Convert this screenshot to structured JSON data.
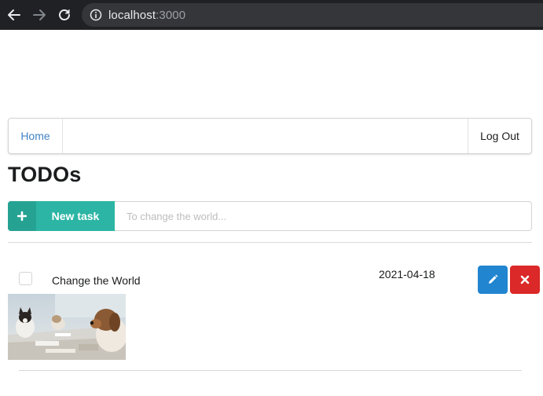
{
  "browser": {
    "url_host": "localhost",
    "url_port": ":3000",
    "back_icon": "arrow-left-icon",
    "forward_icon": "arrow-right-icon",
    "reload_icon": "reload-icon",
    "info_icon": "info-icon"
  },
  "menu": {
    "home_label": "Home",
    "logout_label": "Log Out"
  },
  "page": {
    "title": "TODOs"
  },
  "new_task": {
    "button_label": "New task",
    "button_icon": "plus-icon",
    "input_value": "",
    "input_placeholder": "To change the world..."
  },
  "todos": [
    {
      "checked": false,
      "title": "Change the World",
      "date": "2021-04-18",
      "image": "dogs-at-meeting-table",
      "edit_icon": "pencil-icon",
      "delete_icon": "close-icon"
    }
  ],
  "colors": {
    "chrome_bg": "#202124",
    "link": "#4183c4",
    "teal": "#2cb5a5",
    "blue": "#2185d0",
    "red": "#db2828"
  }
}
